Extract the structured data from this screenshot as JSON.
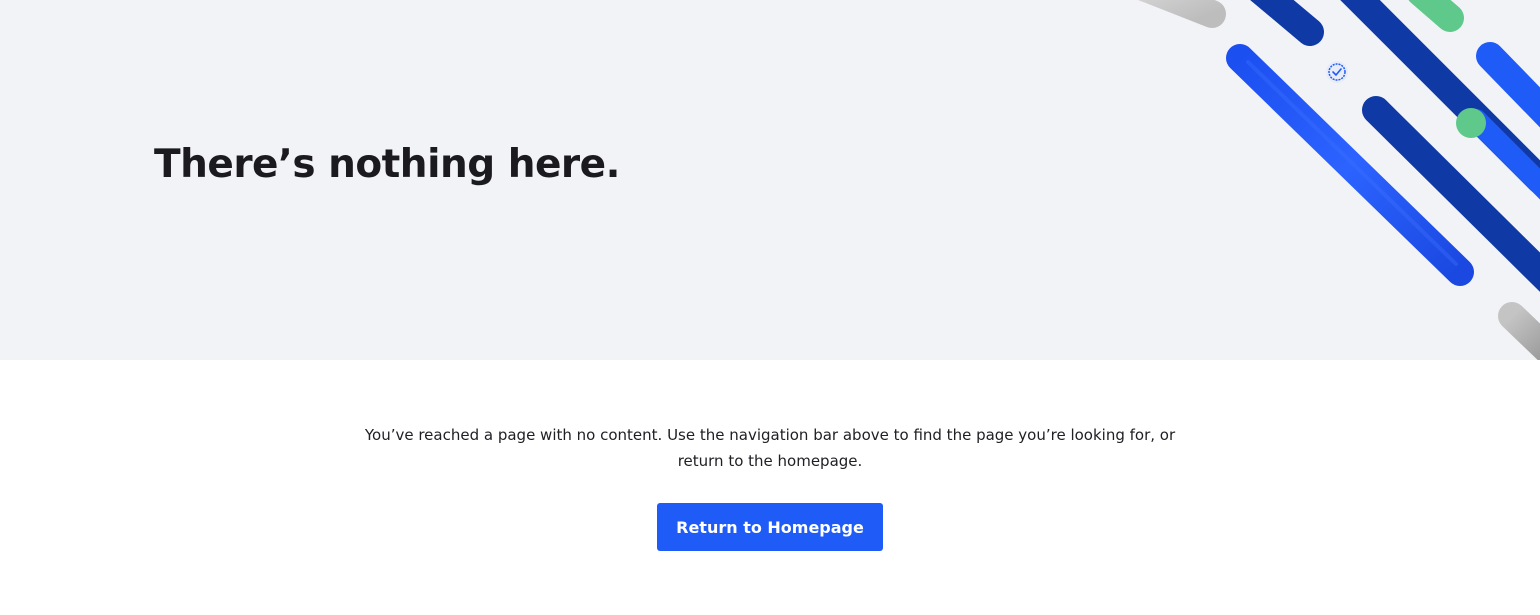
{
  "hero": {
    "title": "There’s nothing here."
  },
  "content": {
    "message": "You’ve reached a page with no content. Use the navigation bar above to find the page you’re looking for, or return to the homepage.",
    "button_label": "Return to Homepage"
  },
  "colors": {
    "hero_background": "#f2f3f7",
    "brand_blue": "#1f5cf7",
    "dark_blue": "#0f3aa6",
    "green": "#5ec98a",
    "gray": "#b8b8b8"
  },
  "icons": {
    "badge": "check-badge-icon"
  }
}
